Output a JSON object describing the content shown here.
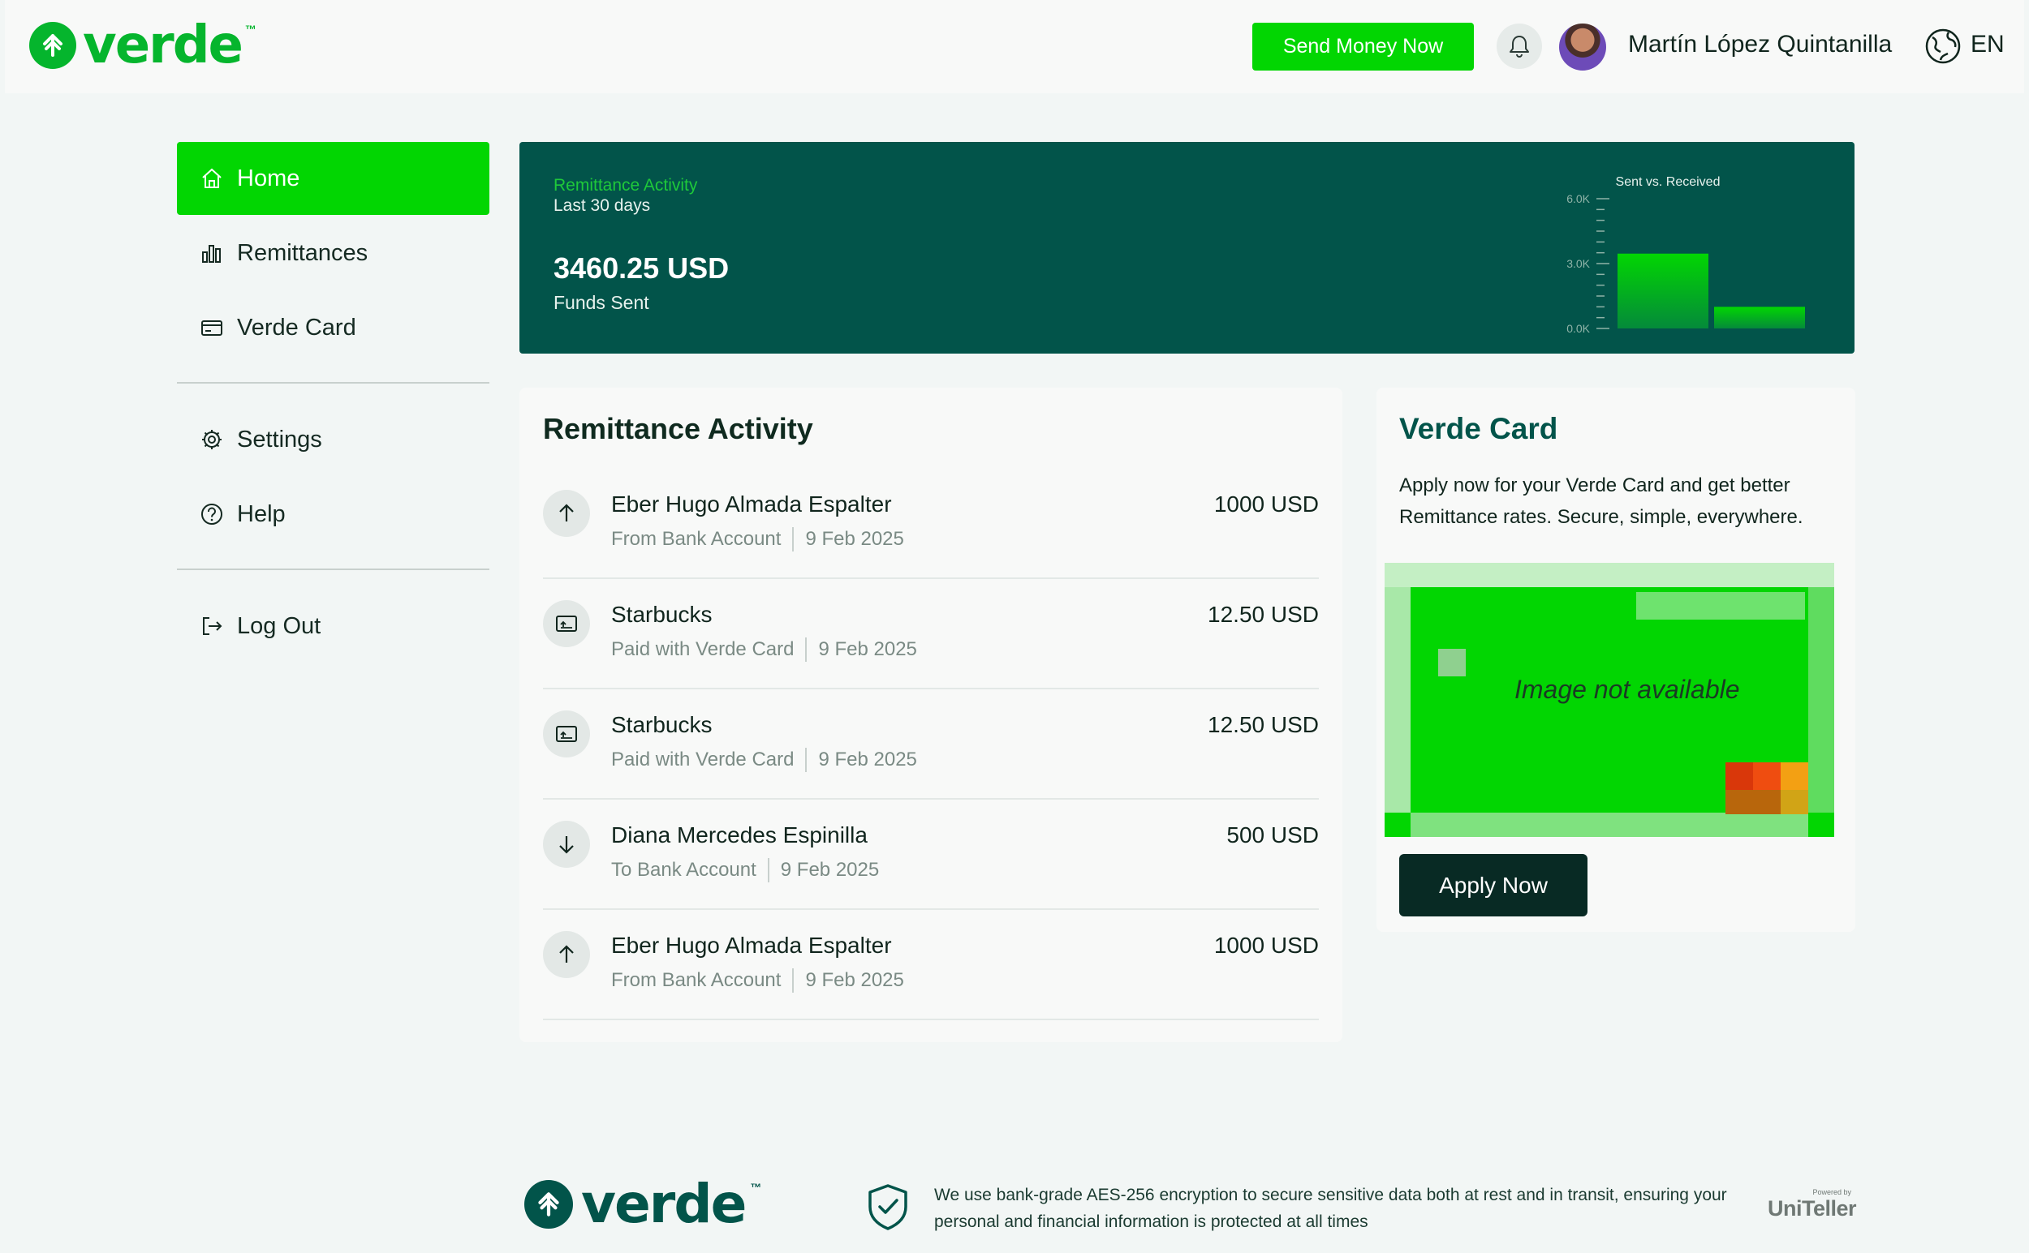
{
  "brand": {
    "name": "verde",
    "tm": "™",
    "accent": "#02d602",
    "dark": "#02544a"
  },
  "header": {
    "send_button": "Send Money Now",
    "user_name": "Martín López Quintanilla",
    "language": "EN"
  },
  "sidebar": {
    "items": [
      {
        "label": "Home",
        "icon": "home-icon",
        "active": true
      },
      {
        "label": "Remittances",
        "icon": "bar-chart-icon",
        "active": false
      },
      {
        "label": "Verde Card",
        "icon": "card-icon",
        "active": false
      },
      {
        "label": "Settings",
        "icon": "gear-icon",
        "active": false
      },
      {
        "label": "Help",
        "icon": "help-icon",
        "active": false
      },
      {
        "label": "Log Out",
        "icon": "logout-icon",
        "active": false
      }
    ]
  },
  "banner": {
    "label": "Remittance Activity",
    "period": "Last 30 days",
    "amount": "3460.25 USD",
    "caption": "Funds Sent"
  },
  "chart_data": {
    "type": "bar",
    "title": "Sent vs. Received",
    "categories": [
      "Sent",
      "Received"
    ],
    "values": [
      3460.25,
      1000
    ],
    "yticks": [
      "6.0K",
      "3.0K",
      "0.0K"
    ],
    "ylim": [
      0,
      6000
    ],
    "grid": false
  },
  "activity": {
    "title": "Remittance Activity",
    "rows": [
      {
        "name": "Eber Hugo Almada Espalter",
        "source": "From Bank Account",
        "date": "9 Feb 2025",
        "amount": "1000 USD",
        "icon": "arrow-up-icon"
      },
      {
        "name": "Starbucks",
        "source": "Paid with Verde Card",
        "date": "9 Feb 2025",
        "amount": "12.50 USD",
        "icon": "card-payment-icon"
      },
      {
        "name": "Starbucks",
        "source": "Paid with Verde Card",
        "date": "9 Feb 2025",
        "amount": "12.50 USD",
        "icon": "card-payment-icon"
      },
      {
        "name": "Diana Mercedes Espinilla",
        "source": "To Bank Account",
        "date": "9 Feb 2025",
        "amount": "500 USD",
        "icon": "arrow-down-icon"
      },
      {
        "name": "Eber Hugo Almada Espalter",
        "source": "From Bank Account",
        "date": "9 Feb 2025",
        "amount": "1000 USD",
        "icon": "arrow-up-icon"
      }
    ]
  },
  "verde_card": {
    "title": "Verde Card",
    "text": "Apply now for your Verde Card and get better Remittance rates. Secure, simple, everywhere.",
    "image_alt": "Image not available",
    "apply_button": "Apply Now"
  },
  "footer": {
    "security_text": "We use bank-grade AES-256 encryption to secure sensitive data both at rest and in transit, ensuring your personal and financial information is protected at all times",
    "powered_by": "Powered by",
    "partner": "UniTeller"
  }
}
